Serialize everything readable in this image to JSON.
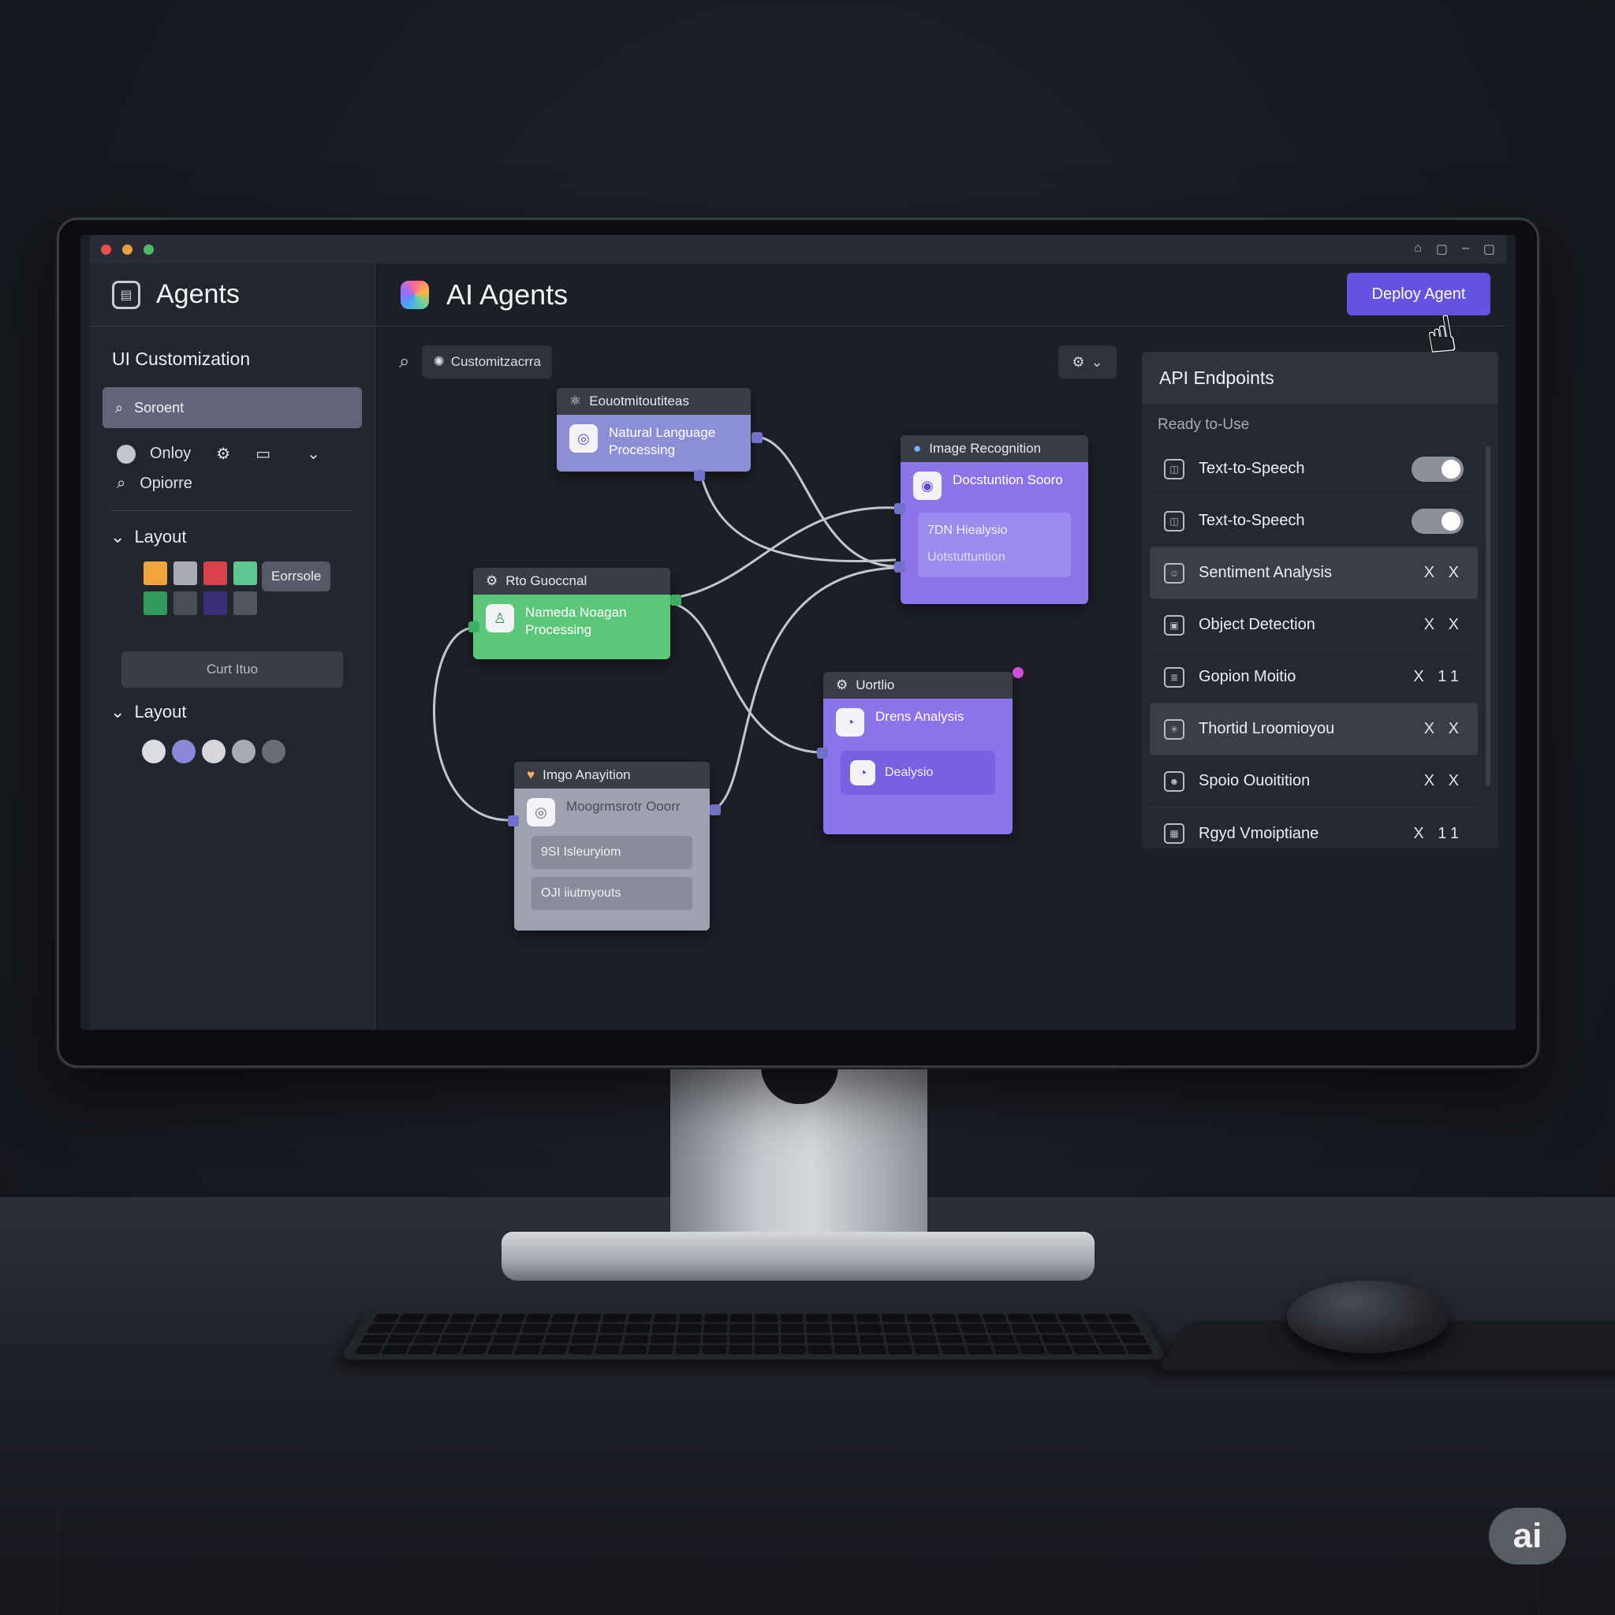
{
  "window": {
    "controls": [
      "⌂",
      "▢",
      "–",
      "▢"
    ]
  },
  "sidebar": {
    "title": "Agents",
    "section_title": "UI Customization",
    "search_value": "Soroent",
    "option_row_label": "Onloy",
    "option_label": "Opiorre",
    "layout1": {
      "label": "Layout",
      "swatches": [
        "#f0a43a",
        "#a9abb3",
        "#d8434b",
        "#5cc790",
        "#2f9a5a",
        "#4a4c56",
        "#3b2f78",
        "#52545e"
      ],
      "chip": "Eorrsole"
    },
    "cut_button": "Curt Ituo",
    "layout2": {
      "label": "Layout",
      "circles": [
        "#dcdde2",
        "#8a88d8",
        "#d6d7dc",
        "#a8aab3",
        "#6a6c77"
      ]
    }
  },
  "main": {
    "title": "AI Agents",
    "deploy_button": "Deploy Agent",
    "search_chip": "Customitzacrra"
  },
  "nodes": {
    "nlp_top": {
      "head": "Eouotmitoutiteas",
      "body": "Natural Language Processing"
    },
    "green": {
      "head": "Rto Guoccnal",
      "body": "Nameda Noagan Processing"
    },
    "image_recognition": {
      "head": "Image Recognition",
      "body": "Docstuntion Sooro",
      "sub1": "7DN Hiealysio",
      "sub2": "Uotstuttuntion"
    },
    "image_acquisition": {
      "head": "Imgo Anayition",
      "body": "Moogrmsrotr Ooorr",
      "sub1": "9SI Isleuryiom",
      "sub2": "OJI iiutmyouts"
    },
    "data_analysis": {
      "head": "Uortlio",
      "body": "Drens Analysis",
      "sub1": "Dealysio"
    }
  },
  "api_panel": {
    "title": "API Endpoints",
    "subtitle": "Ready to-Use",
    "rows": [
      {
        "label": "Text-to-Speech",
        "action": "toggle"
      },
      {
        "label": "Text-to-Speech",
        "action": "toggle"
      },
      {
        "label": "Sentiment Analysis",
        "action": "X X"
      },
      {
        "label": "Object Detection",
        "action": "X X"
      },
      {
        "label": "Gopion Moitio",
        "action": "X 11"
      },
      {
        "label": "Thortid Lroomioyou",
        "action": "X X"
      },
      {
        "label": "Spoio Ouoitition",
        "action": "X X"
      },
      {
        "label": "Rgyd Vmoiptiane",
        "action": "X 11"
      }
    ]
  },
  "badge": "ai",
  "colors": {
    "accent": "#6552e0",
    "nlp_node": "#8c8fd6",
    "green_node": "#5cc77a",
    "purple_node": "#8b73ea",
    "gray_node": "#9fa2ae"
  }
}
